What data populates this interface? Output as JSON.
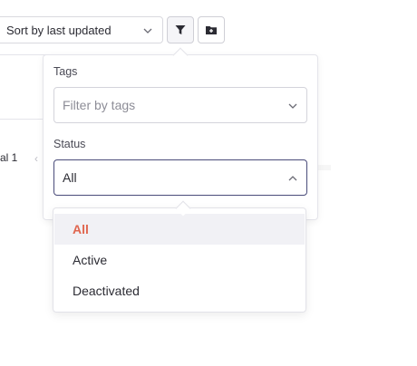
{
  "toolbar": {
    "sort_label": "Sort by last updated",
    "filter_icon": "filter-icon",
    "folder_icon": "folder-plus-icon"
  },
  "background": {
    "row_text": "al 1"
  },
  "filter_panel": {
    "tags_label": "Tags",
    "tags_placeholder": "Filter by tags",
    "status_label": "Status",
    "status_value": "All"
  },
  "status_options": [
    {
      "label": "All",
      "selected": true
    },
    {
      "label": "Active",
      "selected": false
    },
    {
      "label": "Deactivated",
      "selected": false
    }
  ],
  "colors": {
    "selected_text": "#e0664f",
    "focus_border": "#4a4c7a"
  }
}
